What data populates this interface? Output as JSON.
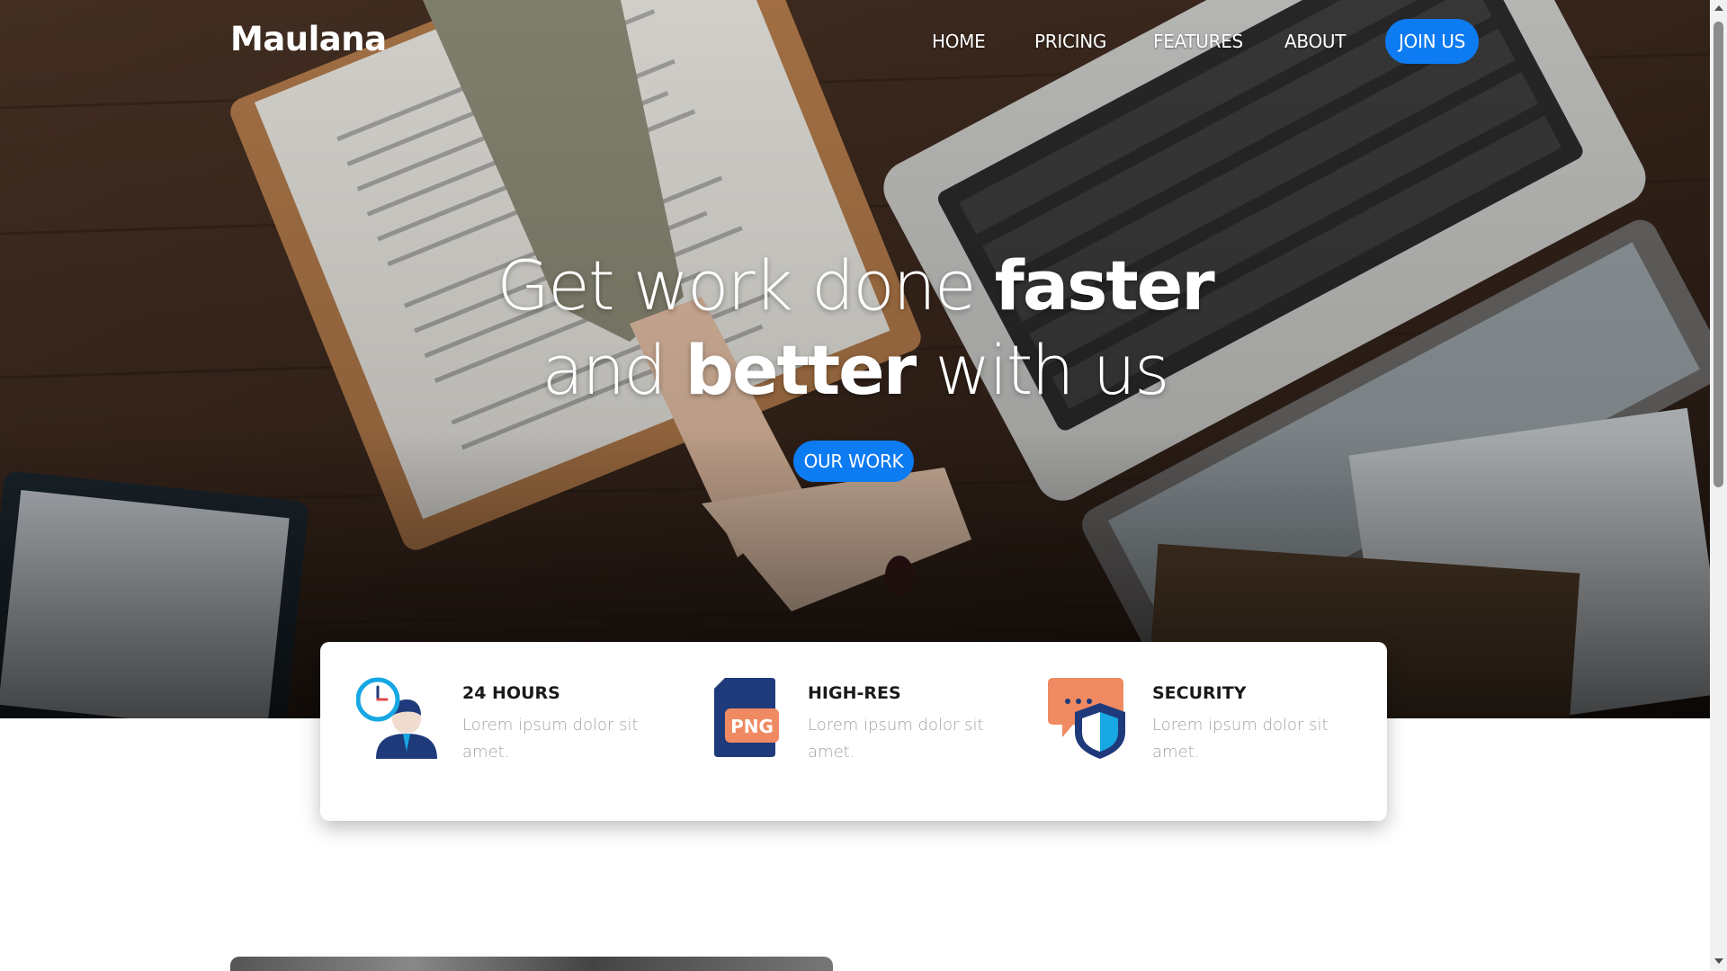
{
  "header": {
    "brand": "Maulana",
    "nav": [
      "HOME",
      "PRICING",
      "FEATURES",
      "ABOUT"
    ],
    "join_label": "JOIN US"
  },
  "hero": {
    "line1_prefix": "Get work done ",
    "line1_bold": "faster",
    "line2_prefix": "and ",
    "line2_bold": "better",
    "line2_suffix": " with us",
    "cta_label": "OUR WORK"
  },
  "features": [
    {
      "title": "24 HOURS",
      "text": "Lorem ipsum dolor sit amet.",
      "icon": "clock-person-icon"
    },
    {
      "title": "HIGH-RES",
      "text": "Lorem ipsum dolor sit amet.",
      "icon": "png-file-icon",
      "icon_text": "PNG"
    },
    {
      "title": "SECURITY",
      "text": "Lorem ipsum dolor sit amet.",
      "icon": "shield-chat-icon"
    }
  ],
  "colors": {
    "accent": "#0d7bf2",
    "icon_navy": "#1f3a7a",
    "icon_orange": "#f08a62",
    "icon_cyan": "#17a8e3"
  }
}
